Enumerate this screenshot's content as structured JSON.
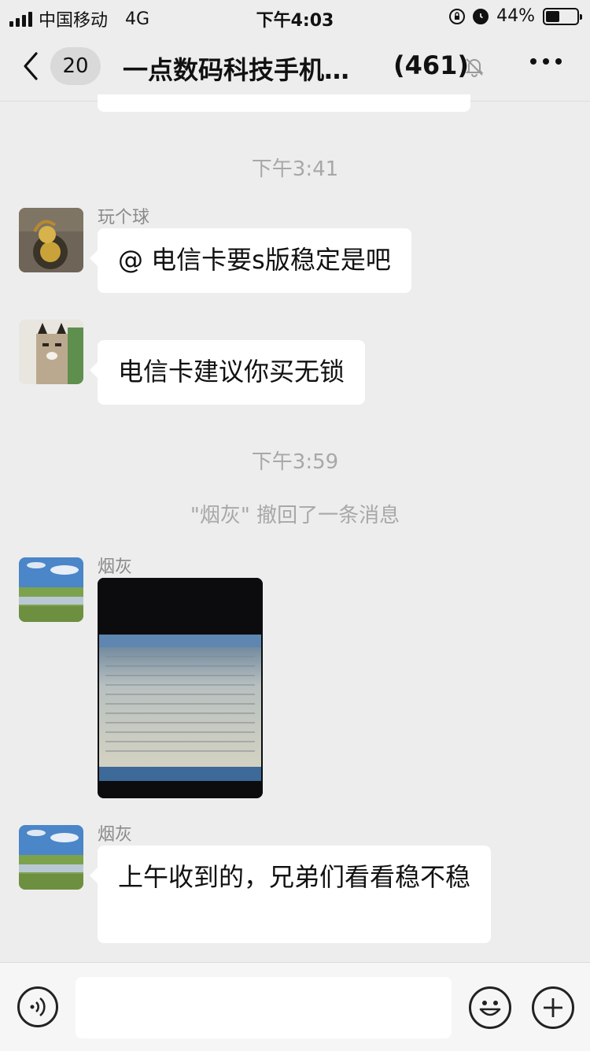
{
  "status_bar": {
    "carrier": "中国移动",
    "network": "4G",
    "time": "下午4:03",
    "battery_text": "44%",
    "battery_level": 0.44,
    "icons": [
      "signal-icon",
      "orientation-lock-icon",
      "alarm-icon",
      "battery-icon"
    ]
  },
  "nav": {
    "back_icon": "chevron-left-icon",
    "unread_count": "20",
    "title": "一点数码科技手机…",
    "member_count": "(461)",
    "mute_icon": "bell-slash-icon",
    "more_icon": "ellipsis-icon"
  },
  "messages": {
    "time_1": "下午3:41",
    "msg_1": {
      "sender": "玩个球",
      "text": "@ 电信卡要s版稳定是吧"
    },
    "msg_2": {
      "text": "电信卡建议你买无锁"
    },
    "time_2": "下午3:59",
    "system_notice": "\"烟灰\" 撤回了一条消息",
    "msg_3": {
      "sender": "烟灰",
      "type": "image"
    },
    "msg_4": {
      "sender": "烟灰",
      "text": "上午收到的，兄弟们看看稳不稳"
    }
  },
  "input_bar": {
    "voice_icon": "voice-icon",
    "input_value": "",
    "emoji_icon": "emoji-icon",
    "plus_icon": "plus-icon"
  }
}
